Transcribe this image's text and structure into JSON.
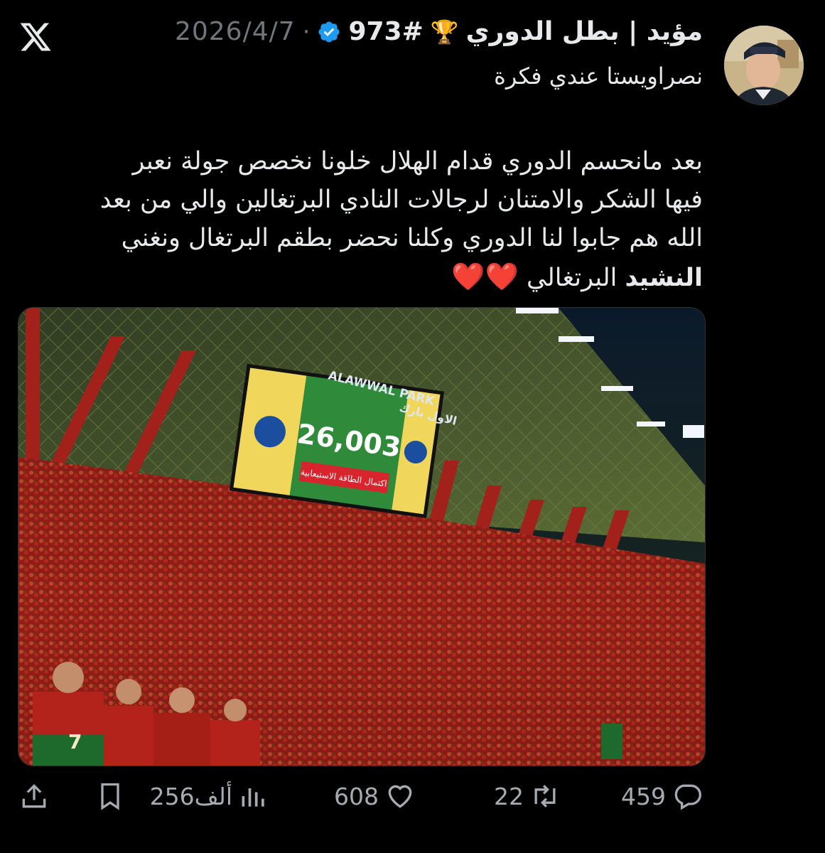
{
  "author": {
    "display_name": "مؤيد | بطل الدوري",
    "trophy": "🏆",
    "hashtag": "973#",
    "date": "2026/4/7",
    "separator": "·",
    "subtitle": "نصراويستا عندي فكرة"
  },
  "tweet": {
    "line1": "بعد مانحسم الدوري قدام الهلال خلونا نخصص جولة نعبر",
    "line2": "فيها الشكر والامتنان لرجالات النادي البرتغالين والي من بعد",
    "line3": "الله هم جابوا لنا الدوري وكلنا نحضر بطقم البرتغال ونغني",
    "line4_bold": "النشيد",
    "line4_rest": " البرتغالي ",
    "hearts": "❤️❤️"
  },
  "media": {
    "scoreboard_number": "26,003",
    "scoreboard_caption": "اكتمال الطاقة الاستيعابية",
    "stadium_sign": "ALAWWAL PARK",
    "stadium_sign_ar": "الاول بارك"
  },
  "actions": {
    "replies": "459",
    "reposts": "22",
    "likes": "608",
    "views": "256ألف"
  },
  "colors": {
    "background": "#000000",
    "text": "#e7e9ea",
    "muted": "#71767b",
    "verified": "#1d9bf0",
    "heart": "#e0263a"
  }
}
